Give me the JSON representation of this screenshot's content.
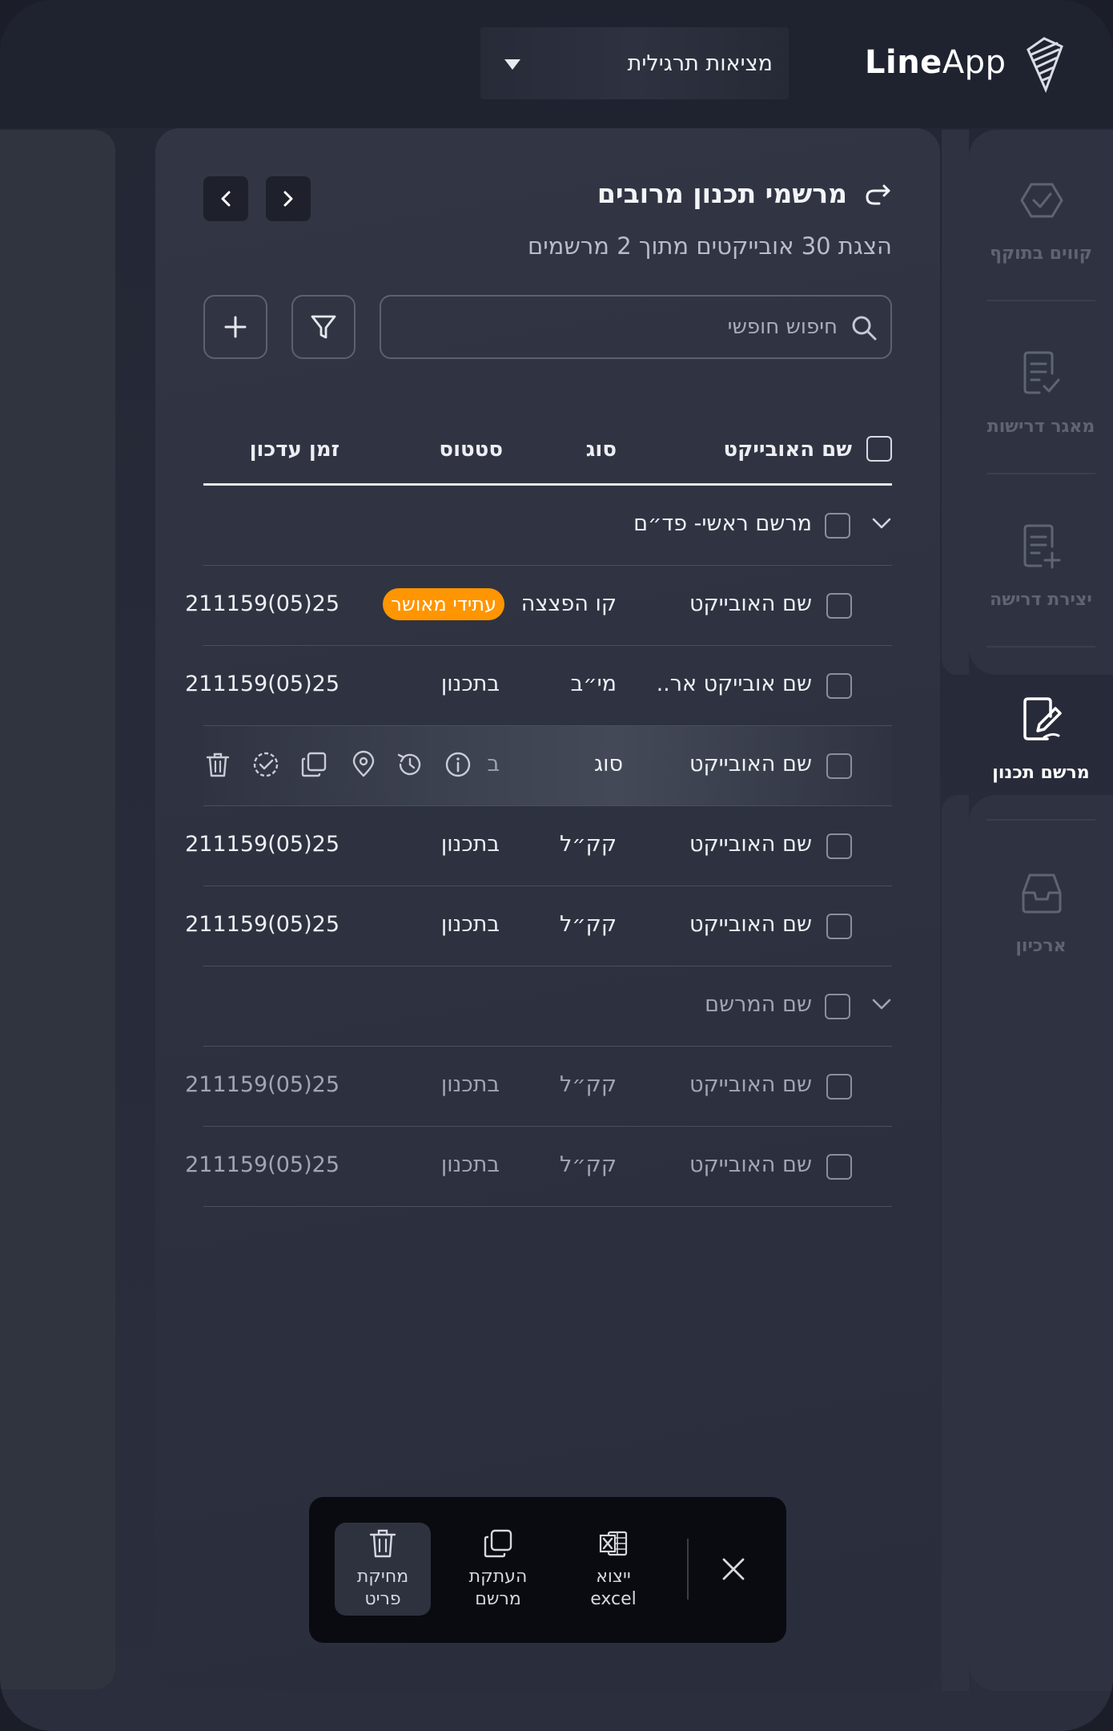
{
  "header": {
    "brand_bold": "Line",
    "brand_light": "App",
    "project_select": "מציאות תרגילית"
  },
  "sidebar": {
    "items": [
      {
        "label": "קווים בתוקף",
        "icon": "check-hexagon-icon",
        "active": false
      },
      {
        "label": "מאגר דרישות",
        "icon": "document-check-icon",
        "active": false
      },
      {
        "label": "יצירת דרישה",
        "icon": "document-add-icon",
        "active": false
      },
      {
        "label": "מרשם תכנון",
        "icon": "edit-document-icon",
        "active": true
      },
      {
        "label": "ארכיון",
        "icon": "archive-box-icon",
        "active": false
      }
    ]
  },
  "main": {
    "title": "מרשמי תכנון מרובים",
    "subtitle": "הצגת 30 אובייקטים מתוך 2 מרשמים",
    "search_placeholder": "חיפוש חופשי",
    "table": {
      "headers": {
        "name": "שם האובייקט",
        "type": "סוג",
        "status": "סטטוס",
        "time": "זמן עדכון"
      },
      "groups": [
        {
          "name": "מרשם ראשי- פד״ם",
          "rows": [
            {
              "name": "שם האובייקט",
              "type": "קו הפצצה",
              "status": "עתידי מאושר",
              "time": "25(05)211159",
              "badge": true
            },
            {
              "name": "שם אובייקט אר..",
              "type": "מי״ב",
              "status": "בתכנון",
              "time": "25(05)211159"
            },
            {
              "name": "שם האובייקט",
              "type": "סוג",
              "status": "ב",
              "time": "",
              "hover": true
            },
            {
              "name": "שם האובייקט",
              "type": "קק״ל",
              "status": "בתכנון",
              "time": "25(05)211159"
            },
            {
              "name": "שם האובייקט",
              "type": "קק״ל",
              "status": "בתכנון",
              "time": "25(05)211159"
            }
          ]
        },
        {
          "name": "שם המרשם",
          "rows": [
            {
              "name": "שם האובייקט",
              "type": "קק״ל",
              "status": "בתכנון",
              "time": "25(05)211159"
            },
            {
              "name": "שם האובייקט",
              "type": "קק״ל",
              "status": "בתכנון",
              "time": "25(05)211159"
            }
          ]
        }
      ]
    }
  },
  "bulkbar": {
    "delete_line1": "מחיקת",
    "delete_line2": "פריט",
    "copy_line1": "העתקת",
    "copy_line2": "מרשם",
    "export_line1": "ייצוא",
    "export_line2": "excel"
  },
  "colors": {
    "accent": "#ff9500",
    "panel": "#2c303d",
    "background": "#232734"
  }
}
